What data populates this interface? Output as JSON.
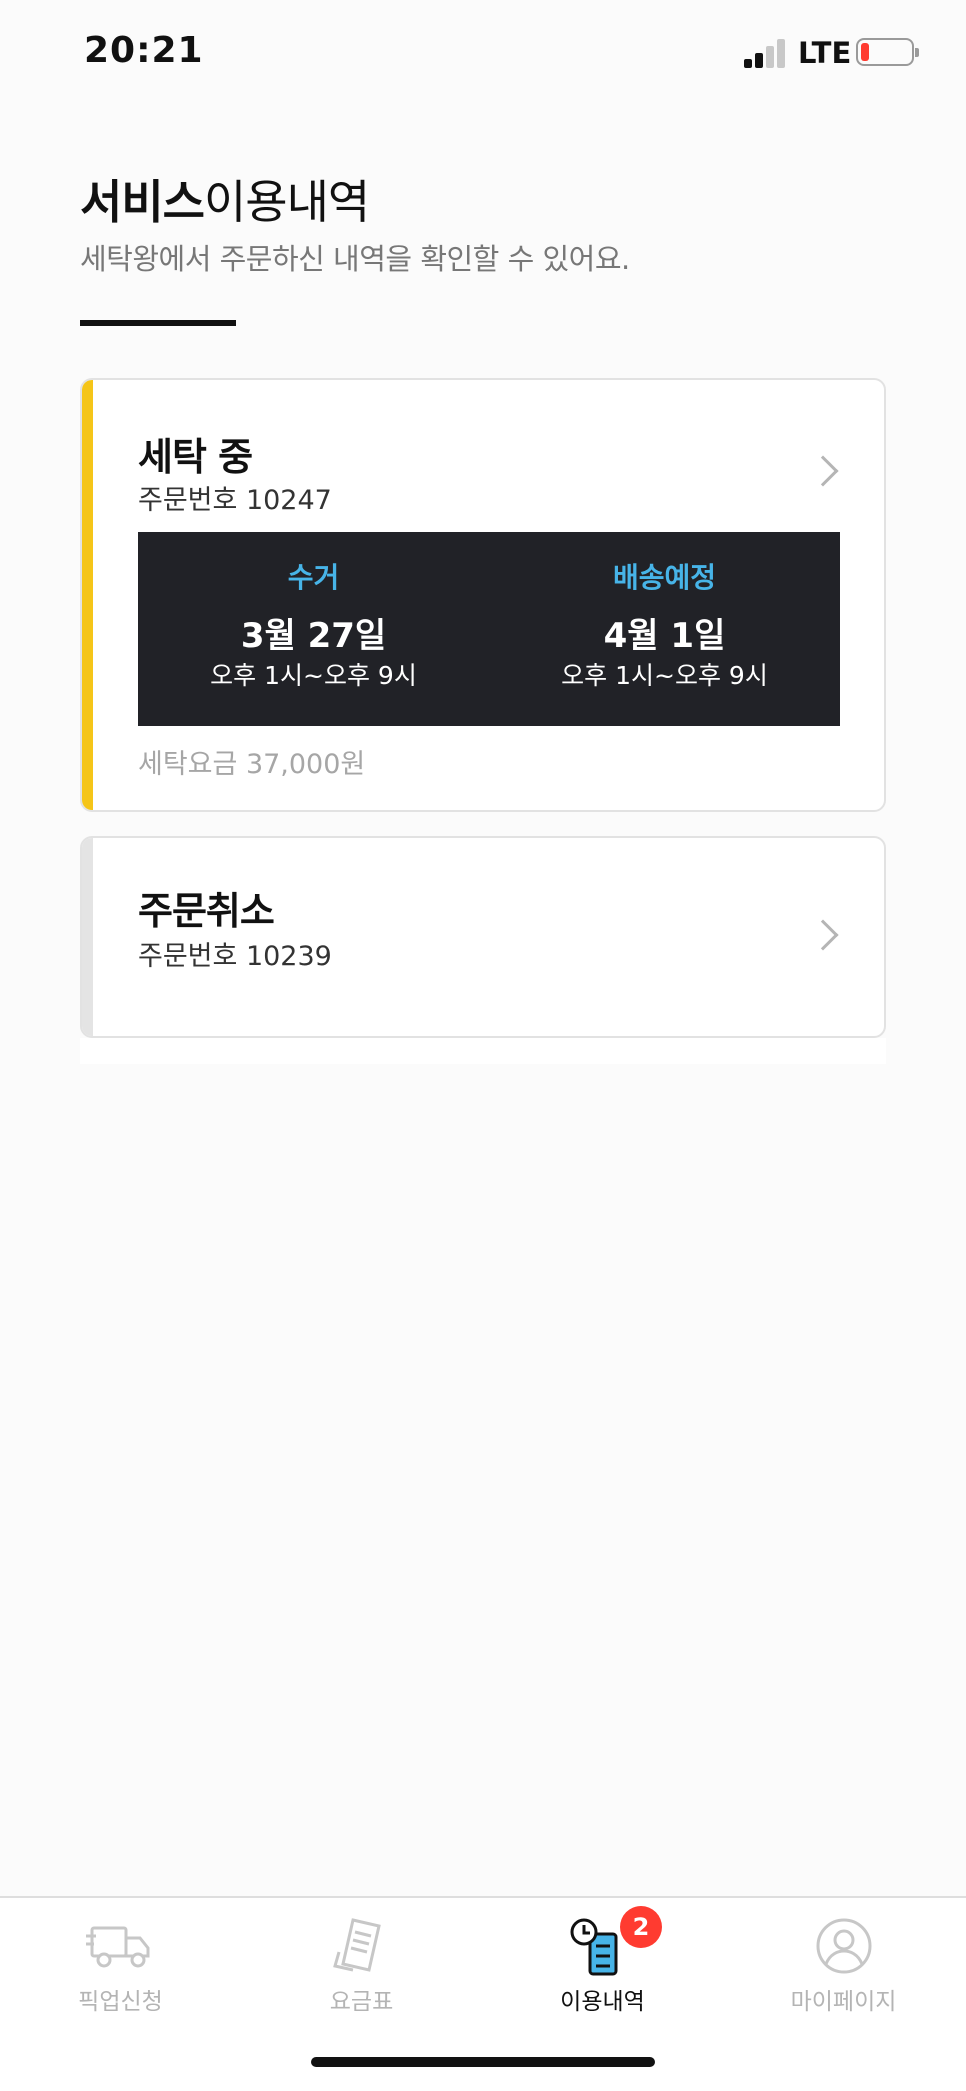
{
  "status_bar": {
    "time": "20:21",
    "network": "LTE"
  },
  "header": {
    "title_strong": "서비스",
    "title_light": "이용내역",
    "subtitle": "세탁왕에서 주문하신 내역을 확인할 수 있어요."
  },
  "orders": [
    {
      "status": "세탁 중",
      "order_number": "주문번호 10247",
      "pickup": {
        "label": "수거",
        "date": "3월 27일",
        "time": "오후 1시~오후 9시"
      },
      "delivery": {
        "label": "배송예정",
        "date": "4월 1일",
        "time": "오후 1시~오후 9시"
      },
      "fee": "세탁요금 37,000원",
      "accent_color": "#f5c518"
    },
    {
      "status": "주문취소",
      "order_number": "주문번호 10239",
      "accent_color": "#e4e4e4"
    }
  ],
  "tab_bar": {
    "tabs": [
      {
        "label": "픽업신청",
        "icon": "truck-icon",
        "active": false
      },
      {
        "label": "요금표",
        "icon": "receipt-icon",
        "active": false
      },
      {
        "label": "이용내역",
        "icon": "history-icon",
        "active": true,
        "badge": "2"
      },
      {
        "label": "마이페이지",
        "icon": "user-icon",
        "active": false
      }
    ]
  },
  "colors": {
    "accent_yellow": "#f5c518",
    "info_blue": "#47b4e8",
    "badge_red": "#ff3b30",
    "dark_panel": "#212227"
  }
}
